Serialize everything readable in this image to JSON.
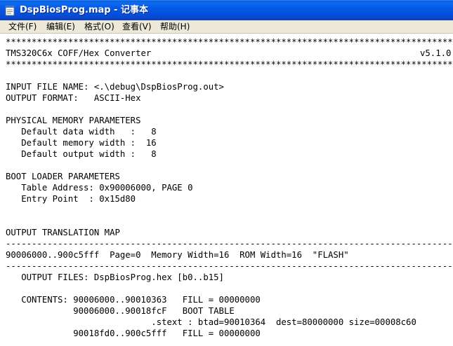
{
  "window": {
    "title": "DspBiosProg.map - 记事本",
    "icon": "notepad-icon"
  },
  "menu": {
    "items": [
      {
        "label": "文件(F)"
      },
      {
        "label": "编辑(E)"
      },
      {
        "label": "格式(O)"
      },
      {
        "label": "查看(V)"
      },
      {
        "label": "帮助(H)"
      }
    ]
  },
  "document": {
    "lines": [
      "***************************************************************************************",
      "TMS320C6x COFF/Hex Converter",
      "***************************************************************************************",
      "",
      "INPUT FILE NAME: <.\\debug\\DspBiosProg.out>",
      "OUTPUT FORMAT:   ASCII-Hex",
      "",
      "PHYSICAL MEMORY PARAMETERS",
      "   Default data width   :   8",
      "   Default memory width :  16",
      "   Default output width :   8",
      "",
      "BOOT LOADER PARAMETERS",
      "   Table Address: 0x90006000, PAGE 0",
      "   Entry Point  : 0x15d80",
      "",
      "",
      "OUTPUT TRANSLATION MAP",
      "---------------------------------------------------------------------------------------",
      "90006000..900c5fff  Page=0  Memory Width=16  ROM Width=16  \"FLASH\"",
      "---------------------------------------------------------------------------------------",
      "   OUTPUT FILES: DspBiosProg.hex [b0..b15]",
      "",
      "   CONTENTS: 90006000..90010363   FILL = 00000000",
      "             90006000..90018fcF   BOOT TABLE",
      "                            .stext : btad=90010364  dest=80000000 size=00008c60",
      "             90018fd0..900c5fff   FILL = 00000000"
    ],
    "version": "v5.1.0"
  }
}
